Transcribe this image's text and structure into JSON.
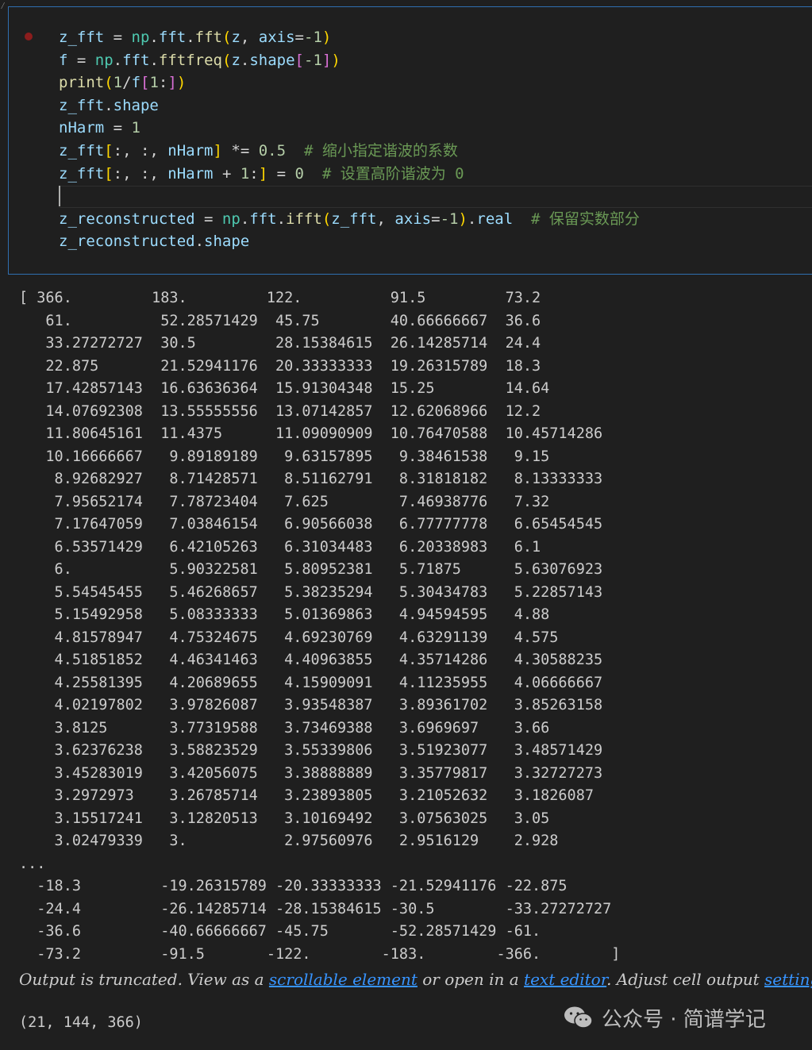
{
  "code_cell": {
    "lines": [
      [
        [
          "var",
          "z_fft"
        ],
        [
          "op",
          " = "
        ],
        [
          "mod",
          "np"
        ],
        [
          "op",
          "."
        ],
        [
          "var",
          "fft"
        ],
        [
          "op",
          "."
        ],
        [
          "fn",
          "fft"
        ],
        [
          "p1",
          "("
        ],
        [
          "var",
          "z"
        ],
        [
          "op",
          ", "
        ],
        [
          "var",
          "axis"
        ],
        [
          "op",
          "="
        ],
        [
          "num",
          "-1"
        ],
        [
          "p1",
          ")"
        ]
      ],
      [
        [
          "var",
          "f"
        ],
        [
          "op",
          " = "
        ],
        [
          "mod",
          "np"
        ],
        [
          "op",
          "."
        ],
        [
          "var",
          "fft"
        ],
        [
          "op",
          "."
        ],
        [
          "fn",
          "fftfreq"
        ],
        [
          "p1",
          "("
        ],
        [
          "var",
          "z"
        ],
        [
          "op",
          "."
        ],
        [
          "var",
          "shape"
        ],
        [
          "p2",
          "["
        ],
        [
          "num",
          "-1"
        ],
        [
          "p2",
          "]"
        ],
        [
          "p1",
          ")"
        ]
      ],
      [
        [
          "fn",
          "print"
        ],
        [
          "p1",
          "("
        ],
        [
          "num",
          "1"
        ],
        [
          "op",
          "/"
        ],
        [
          "var",
          "f"
        ],
        [
          "p2",
          "["
        ],
        [
          "num",
          "1"
        ],
        [
          "op",
          ":"
        ],
        [
          "p2",
          "]"
        ],
        [
          "p1",
          ")"
        ]
      ],
      [
        [
          "var",
          "z_fft"
        ],
        [
          "op",
          "."
        ],
        [
          "var",
          "shape"
        ]
      ],
      [
        [
          "var",
          "nHarm"
        ],
        [
          "op",
          " = "
        ],
        [
          "num",
          "1"
        ]
      ],
      [
        [
          "var",
          "z_fft"
        ],
        [
          "p1",
          "["
        ],
        [
          "op",
          ":, :, "
        ],
        [
          "var",
          "nHarm"
        ],
        [
          "p1",
          "]"
        ],
        [
          "op",
          " *= "
        ],
        [
          "num",
          "0.5"
        ],
        [
          "op",
          "  "
        ],
        [
          "cm",
          "# 缩小指定谐波的系数"
        ]
      ],
      [
        [
          "var",
          "z_fft"
        ],
        [
          "p1",
          "["
        ],
        [
          "op",
          ":, :, "
        ],
        [
          "var",
          "nHarm"
        ],
        [
          "op",
          " + "
        ],
        [
          "num",
          "1"
        ],
        [
          "op",
          ":"
        ],
        [
          "p1",
          "]"
        ],
        [
          "op",
          " = "
        ],
        [
          "num",
          "0"
        ],
        [
          "op",
          "  "
        ],
        [
          "cm",
          "# 设置高阶谐波为 0"
        ]
      ],
      [
        [
          "op",
          " "
        ]
      ],
      [
        [
          "var",
          "z_reconstructed"
        ],
        [
          "op",
          " = "
        ],
        [
          "mod",
          "np"
        ],
        [
          "op",
          "."
        ],
        [
          "var",
          "fft"
        ],
        [
          "op",
          "."
        ],
        [
          "fn",
          "ifft"
        ],
        [
          "p1",
          "("
        ],
        [
          "var",
          "z_fft"
        ],
        [
          "op",
          ", "
        ],
        [
          "var",
          "axis"
        ],
        [
          "op",
          "="
        ],
        [
          "num",
          "-1"
        ],
        [
          "p1",
          ")"
        ],
        [
          "op",
          "."
        ],
        [
          "var",
          "real"
        ],
        [
          "op",
          "  "
        ],
        [
          "cm",
          "# 保留实数部分"
        ]
      ],
      [
        [
          "var",
          "z_reconstructed"
        ],
        [
          "op",
          "."
        ],
        [
          "var",
          "shape"
        ]
      ]
    ]
  },
  "output": {
    "rows": [
      "[ 366.         183.         122.          91.5         73.2",
      "   61.          52.28571429  45.75        40.66666667  36.6",
      "   33.27272727  30.5         28.15384615  26.14285714  24.4",
      "   22.875       21.52941176  20.33333333  19.26315789  18.3",
      "   17.42857143  16.63636364  15.91304348  15.25        14.64",
      "   14.07692308  13.55555556  13.07142857  12.62068966  12.2",
      "   11.80645161  11.4375      11.09090909  10.76470588  10.45714286",
      "   10.16666667   9.89189189   9.63157895   9.38461538   9.15",
      "    8.92682927   8.71428571   8.51162791   8.31818182   8.13333333",
      "    7.95652174   7.78723404   7.625        7.46938776   7.32",
      "    7.17647059   7.03846154   6.90566038   6.77777778   6.65454545",
      "    6.53571429   6.42105263   6.31034483   6.20338983   6.1",
      "    6.           5.90322581   5.80952381   5.71875      5.63076923",
      "    5.54545455   5.46268657   5.38235294   5.30434783   5.22857143",
      "    5.15492958   5.08333333   5.01369863   4.94594595   4.88",
      "    4.81578947   4.75324675   4.69230769   4.63291139   4.575",
      "    4.51851852   4.46341463   4.40963855   4.35714286   4.30588235",
      "    4.25581395   4.20689655   4.15909091   4.11235955   4.06666667",
      "    4.02197802   3.97826087   3.93548387   3.89361702   3.85263158",
      "    3.8125       3.77319588   3.73469388   3.6969697    3.66",
      "    3.62376238   3.58823529   3.55339806   3.51923077   3.48571429",
      "    3.45283019   3.42056075   3.38888889   3.35779817   3.32727273",
      "    3.2972973    3.26785714   3.23893805   3.21052632   3.1826087",
      "    3.15517241   3.12820513   3.10169492   3.07563025   3.05",
      "    3.02479339   3.           2.97560976   2.9516129    2.928",
      "...",
      "  -18.3         -19.26315789 -20.33333333 -21.52941176 -22.875",
      "  -24.4         -26.14285714 -28.15384615 -30.5        -33.27272727",
      "  -36.6         -40.66666667 -45.75       -52.28571429 -61.",
      "  -73.2         -91.5       -122.        -183.        -366.        ]"
    ],
    "truncated_notice": {
      "prefix": "Output is truncated. View as a ",
      "link1": "scrollable element",
      "middle": " or open in a ",
      "link2": "text editor",
      "suffix_before_link3": ". Adjust cell output ",
      "link3": "settings",
      "suffix": "..."
    },
    "shape_result": "(21, 144, 366)"
  },
  "watermark": {
    "text": "公众号 · 简谱学记",
    "icon": "wechat-icon"
  },
  "colors": {
    "background": "#1f1f1f",
    "cell_border": "#2f6fb0",
    "link": "#3794ff"
  }
}
